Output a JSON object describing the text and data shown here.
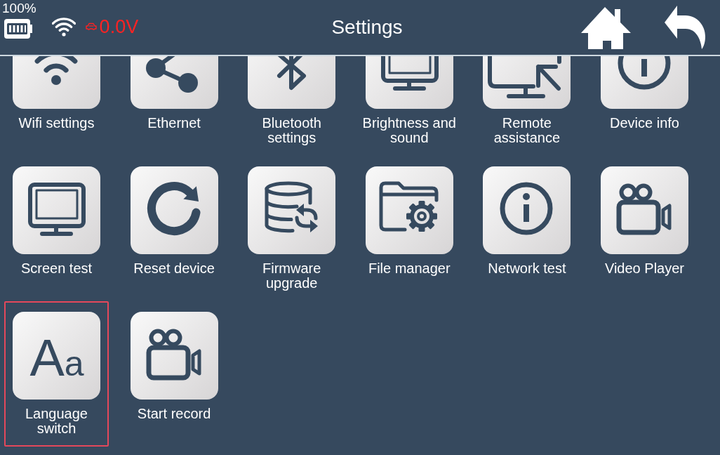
{
  "status_bar": {
    "battery": "100%",
    "voltage": "0.0V"
  },
  "title": "Settings",
  "rows": [
    {
      "clipped": true,
      "items": [
        {
          "kind": "wifi",
          "label": "Wifi settings",
          "selected": false
        },
        {
          "kind": "share",
          "label": "Ethernet",
          "selected": false
        },
        {
          "kind": "bluetooth",
          "label": "Bluetooth settings",
          "selected": false
        },
        {
          "kind": "monitor",
          "label": "Brightness and sound",
          "selected": false
        },
        {
          "kind": "remote",
          "label": "Remote assistance",
          "selected": false
        },
        {
          "kind": "info",
          "label": "Device info",
          "selected": false
        }
      ]
    },
    {
      "clipped": false,
      "items": [
        {
          "kind": "monitor",
          "label": "Screen test",
          "selected": false
        },
        {
          "kind": "reset",
          "label": "Reset device",
          "selected": false
        },
        {
          "kind": "database",
          "label": "Firmware upgrade",
          "selected": false
        },
        {
          "kind": "folder",
          "label": "File manager",
          "selected": false
        },
        {
          "kind": "info",
          "label": "Network test",
          "selected": false
        },
        {
          "kind": "camera",
          "label": "Video Player",
          "selected": false
        }
      ]
    },
    {
      "clipped": false,
      "items": [
        {
          "kind": "letters",
          "label": "Language switch",
          "selected": true,
          "icon_letters": [
            "A",
            "a"
          ]
        },
        {
          "kind": "camera",
          "label": "Start record",
          "selected": false
        }
      ]
    }
  ]
}
